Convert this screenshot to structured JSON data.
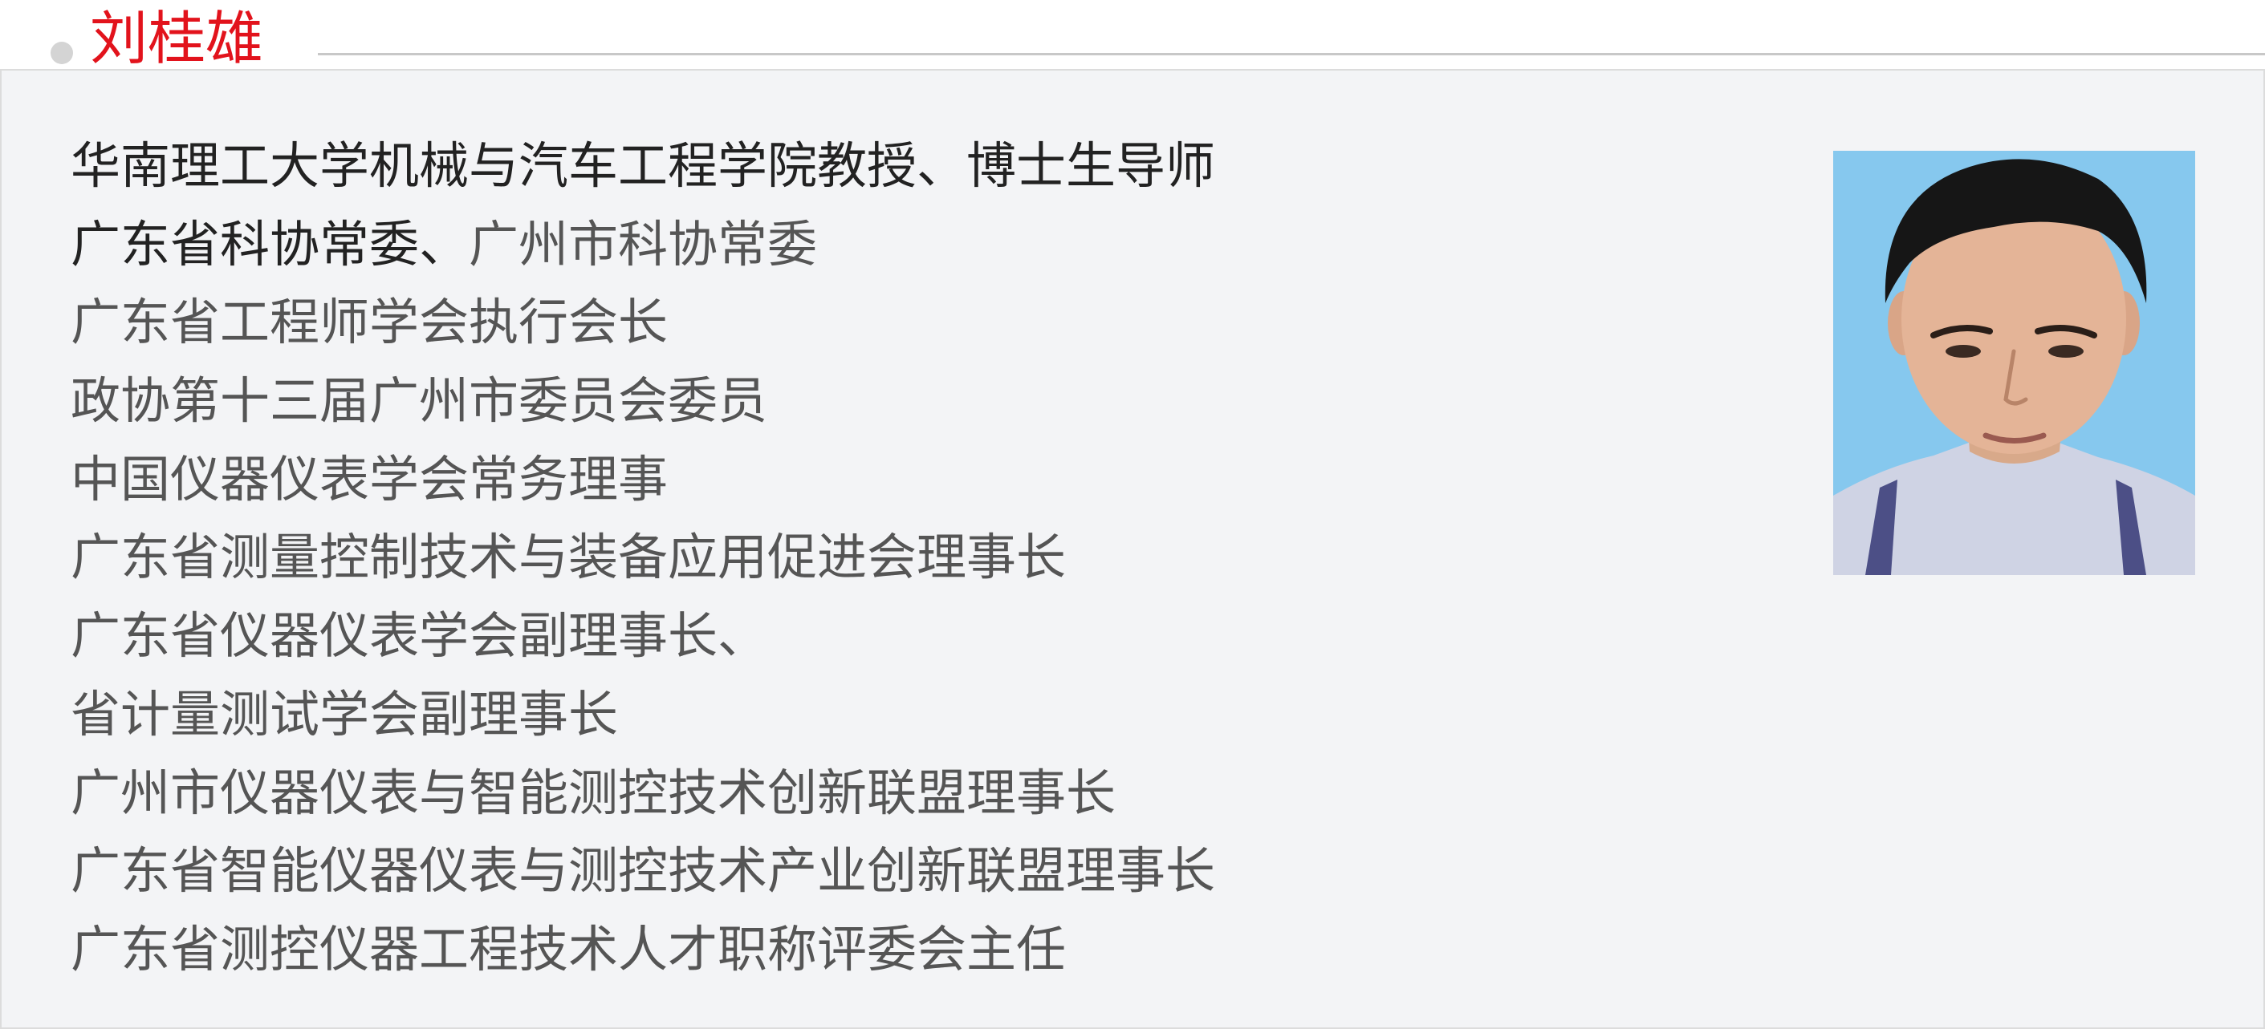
{
  "header": {
    "name": "刘桂雄"
  },
  "roles": [
    "华南理工大学机械与汽车工程学院教授、博士生导师",
    "广东省科协常委、广州市科协常委",
    "广东省工程师学会执行会长",
    "政协第十三届广州市委员会委员",
    "中国仪器仪表学会常务理事",
    "广东省测量控制技术与装备应用促进会理事长",
    "广东省仪器仪表学会副理事长、",
    "省计量测试学会副理事长",
    "广州市仪器仪表与智能测控技术创新联盟理事长",
    "广东省智能仪器仪表与测控技术产业创新联盟理事长",
    "广东省测控仪器工程技术人才职称评委会主任"
  ],
  "role_split": {
    "first_part": "广东省科协常委、",
    "second_part": "广州市科协常委"
  },
  "portrait": {
    "alt": "portrait-photo"
  },
  "colors": {
    "name_red": "#e2131c",
    "card_bg": "#f3f4f6",
    "text_dark": "#222222",
    "text_gray": "#555555",
    "photo_bg": "#86c8ee"
  }
}
